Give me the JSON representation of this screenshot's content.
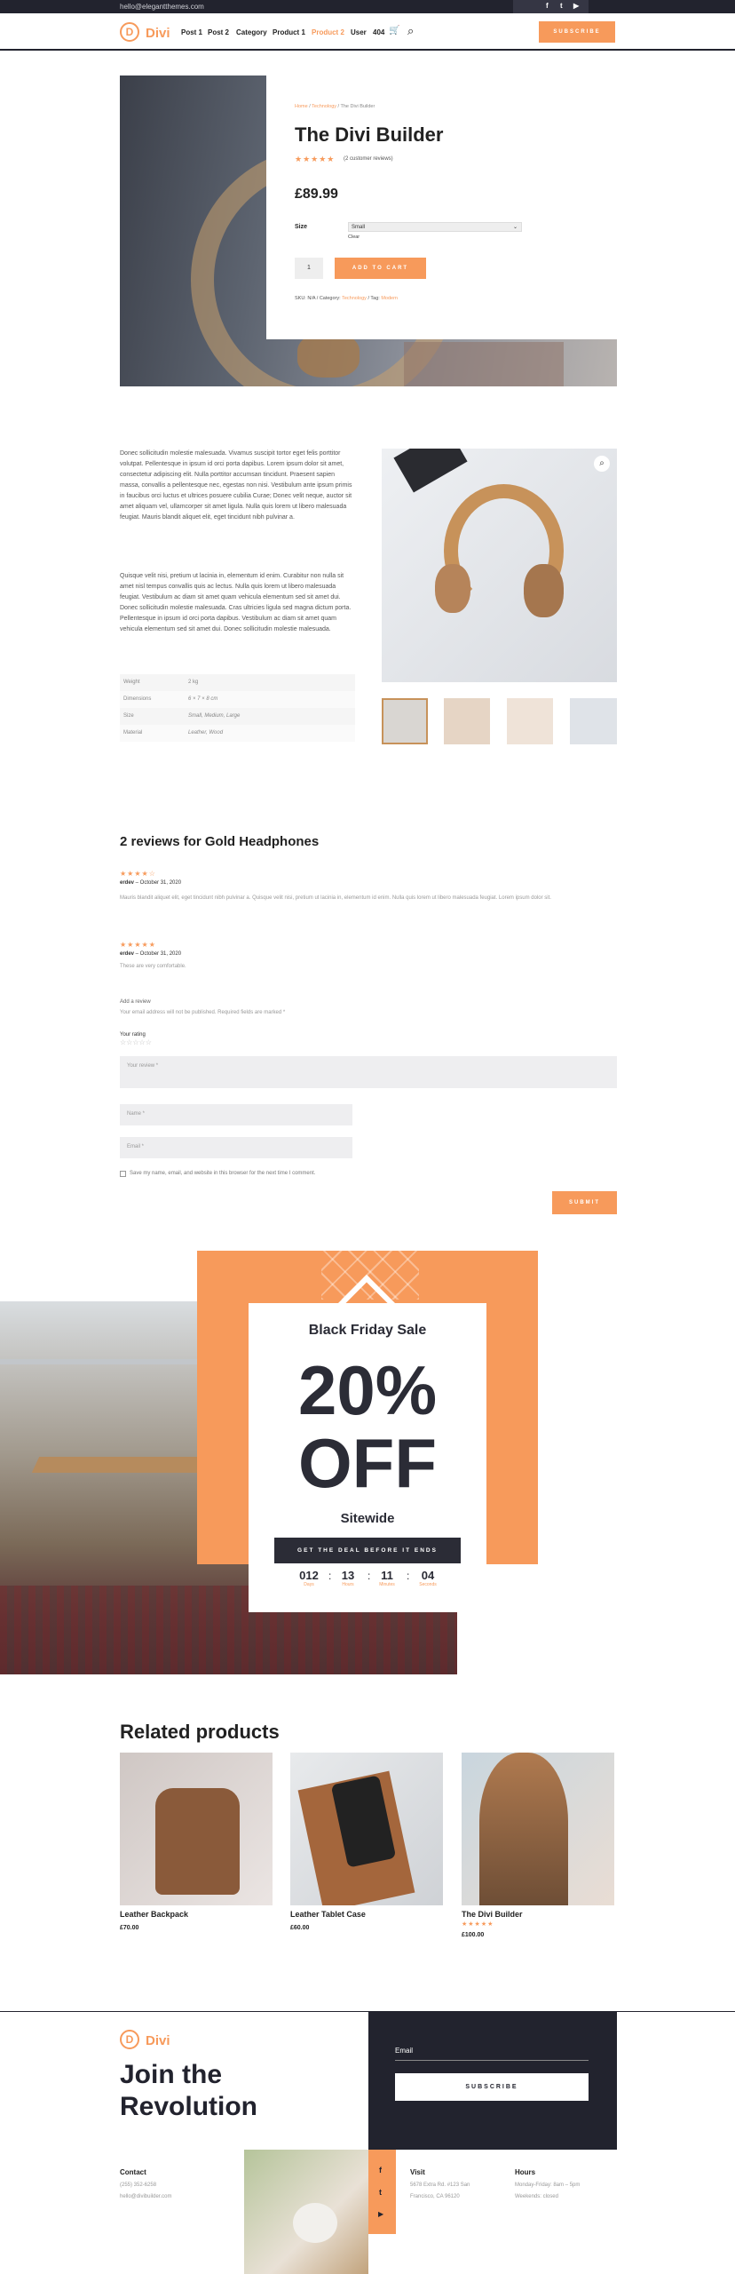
{
  "topbar": {
    "email": "hello@elegantthemes.com",
    "social": [
      "f",
      "t",
      "▶"
    ]
  },
  "header": {
    "logo_letter": "D",
    "logo_text": "Divi",
    "nav": [
      "Post 1",
      "Post 2",
      "Category",
      "Product 1",
      "Product 2",
      "User",
      "404"
    ],
    "cart_icon": "🛒",
    "search_icon": "⌕",
    "subscribe": "SUBSCRIBE"
  },
  "product": {
    "breadcrumb_home": "Home",
    "breadcrumb_sep1": " / ",
    "breadcrumb_cat": "Technology",
    "breadcrumb_sep2": " / ",
    "breadcrumb_current": "The Divi Builder",
    "title": "The Divi Builder",
    "stars": "★★★★★",
    "review_link": "(2 customer reviews)",
    "price": "£89.99",
    "size_label": "Size",
    "size_value": "Small",
    "clear": "Clear",
    "qty": "1",
    "add_to_cart": "ADD TO CART",
    "meta_sku": "SKU: N/A",
    "meta_cat_label": " / Category: ",
    "meta_cat": "Technology",
    "meta_tag_label": " / Tag: ",
    "meta_tag": "Modern"
  },
  "description": {
    "p1": "Donec sollicitudin molestie malesuada. Vivamus suscipit tortor eget felis porttitor volutpat. Pellentesque in ipsum id orci porta dapibus. Lorem ipsum dolor sit amet, consectetur adipiscing elit. Nulla porttitor accumsan tincidunt. Praesent sapien massa, convallis a pellentesque nec, egestas non nisi. Vestibulum ante ipsum primis in faucibus orci luctus et ultrices posuere cubilia Curae; Donec velit neque, auctor sit amet aliquam vel, ullamcorper sit amet ligula. Nulla quis lorem ut libero malesuada feugiat. Mauris blandit aliquet elit, eget tincidunt nibh pulvinar a.",
    "p2": "Quisque velit nisi, pretium ut lacinia in, elementum id enim. Curabitur non nulla sit amet nisl tempus convallis quis ac lectus. Nulla quis lorem ut libero malesuada feugiat. Vestibulum ac diam sit amet quam vehicula elementum sed sit amet dui. Donec sollicitudin molestie malesuada. Cras ultricies ligula sed magna dictum porta. Pellentesque in ipsum id orci porta dapibus. Vestibulum ac diam sit amet quam vehicula elementum sed sit amet dui. Donec sollicitudin molestie malesuada."
  },
  "attributes": [
    {
      "k": "Weight",
      "v": "2 kg"
    },
    {
      "k": "Dimensions",
      "v": "6 × 7 × 8 cm"
    },
    {
      "k": "Size",
      "v": "Small, Medium, Large"
    },
    {
      "k": "Material",
      "v": "Leather, Wood"
    }
  ],
  "reviews": {
    "heading": "2 reviews for Gold Headphones",
    "items": [
      {
        "stars": "★★★★☆",
        "author": "erdev",
        "date": " – October 31, 2020",
        "text": "Mauris blandit aliquet elit, eget tincidunt nibh pulvinar a. Quisque velit nisi, pretium ut lacinia in, elementum id enim. Nulla quis lorem ut libero malesuada feugiat. Lorem ipsum dolor sit."
      },
      {
        "stars": "★★★★★",
        "author": "erdev",
        "date": " – October 31, 2020",
        "text": "These are very comfortable."
      }
    ],
    "form": {
      "add": "Add a review",
      "note": "Your email address will not be published. Required fields are marked *",
      "rating_label": "Your rating",
      "rating_stars": "☆☆☆☆☆",
      "review_ph": "Your review *",
      "name_ph": "Name *",
      "email_ph": "Email *",
      "consent": "Save my name, email, and website in this browser for the next time I comment.",
      "submit": "SUBMIT"
    }
  },
  "promo": {
    "title": "Black Friday Sale",
    "big1": "20%",
    "big2": "OFF",
    "sub": "Sitewide",
    "cta": "GET THE DEAL BEFORE IT ENDS",
    "countdown": [
      {
        "n": "012",
        "l": "Days"
      },
      {
        "n": "13",
        "l": "Hours"
      },
      {
        "n": "11",
        "l": "Minutes"
      },
      {
        "n": "04",
        "l": "Seconds"
      }
    ],
    "sep": ":"
  },
  "related": {
    "heading": "Related products",
    "items": [
      {
        "name": "Leather Backpack",
        "price": "£70.00"
      },
      {
        "name": "Leather Tablet Case",
        "price": "£60.00"
      },
      {
        "name": "The Divi Builder",
        "price": "£100.00",
        "stars": "★★★★★"
      }
    ]
  },
  "footer": {
    "logo_letter": "D",
    "logo_text": "Divi",
    "headline1": "Join the",
    "headline2": "Revolution",
    "email_label": "Email",
    "subscribe": "SUBSCRIBE",
    "contact_h": "Contact",
    "phone": "(255) 352-6258",
    "contact_email": "hello@divibuilder.com",
    "visit_h": "Visit",
    "addr1": "5678 Extra Rd. #123 San",
    "addr2": "Francisco, CA 96120",
    "hours_h": "Hours",
    "hours1": "Monday-Friday: 8am – 5pm",
    "hours2": "Weekends: closed",
    "social": [
      "f",
      "t",
      "▶"
    ]
  }
}
